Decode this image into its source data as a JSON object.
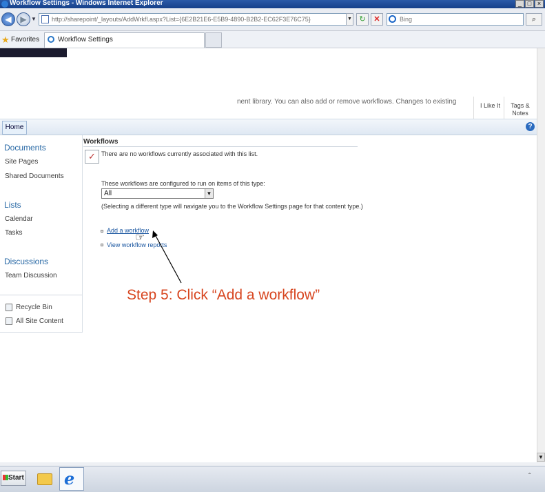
{
  "window": {
    "title": "Workflow Settings - Windows Internet Explorer",
    "buttons": [
      "_",
      "□",
      "×"
    ]
  },
  "browser": {
    "back_icon": "back-arrow-icon",
    "forward_icon": "forward-arrow-icon",
    "address": "http://sharepoint/_layouts/AddWrkfl.aspx?List={6E2B21E6-E5B9-4890-B2B2-EC62F3E76C75}",
    "search_placeholder": "Bing",
    "favorites_label": "Favorites",
    "tab_title": "Workflow Settings"
  },
  "ribbon": {
    "description_fragment": "nent library. You can also add or remove workflows. Changes to existing",
    "i_like_it": "I Like It",
    "tags_notes": "Tags & Notes"
  },
  "topnav": {
    "home": "Home",
    "help": "?"
  },
  "quick_launch": {
    "documents": "Documents",
    "site_pages": "Site Pages",
    "shared_documents": "Shared Documents",
    "lists": "Lists",
    "calendar": "Calendar",
    "tasks": "Tasks",
    "discussions": "Discussions",
    "team_discussion": "Team Discussion",
    "recycle_bin": "Recycle Bin",
    "all_site_content": "All Site Content"
  },
  "main": {
    "title": "Workflows",
    "no_workflows": "There are no workflows currently associated with this list.",
    "configured_text": "These workflows are configured to run on items of this type:",
    "type_selected": "All",
    "selecting_note": "(Selecting a different type will navigate you to the Workflow Settings page for that content type.)",
    "add_workflow": "Add a workflow",
    "view_reports": "View workflow reports"
  },
  "annotation": "Step 5: Click “Add a workflow”",
  "taskbar": {
    "start": "Start"
  },
  "colors": {
    "link": "#1a56a0",
    "annotation": "#d7451f",
    "quick_launch_heading": "#2a6aa6"
  }
}
